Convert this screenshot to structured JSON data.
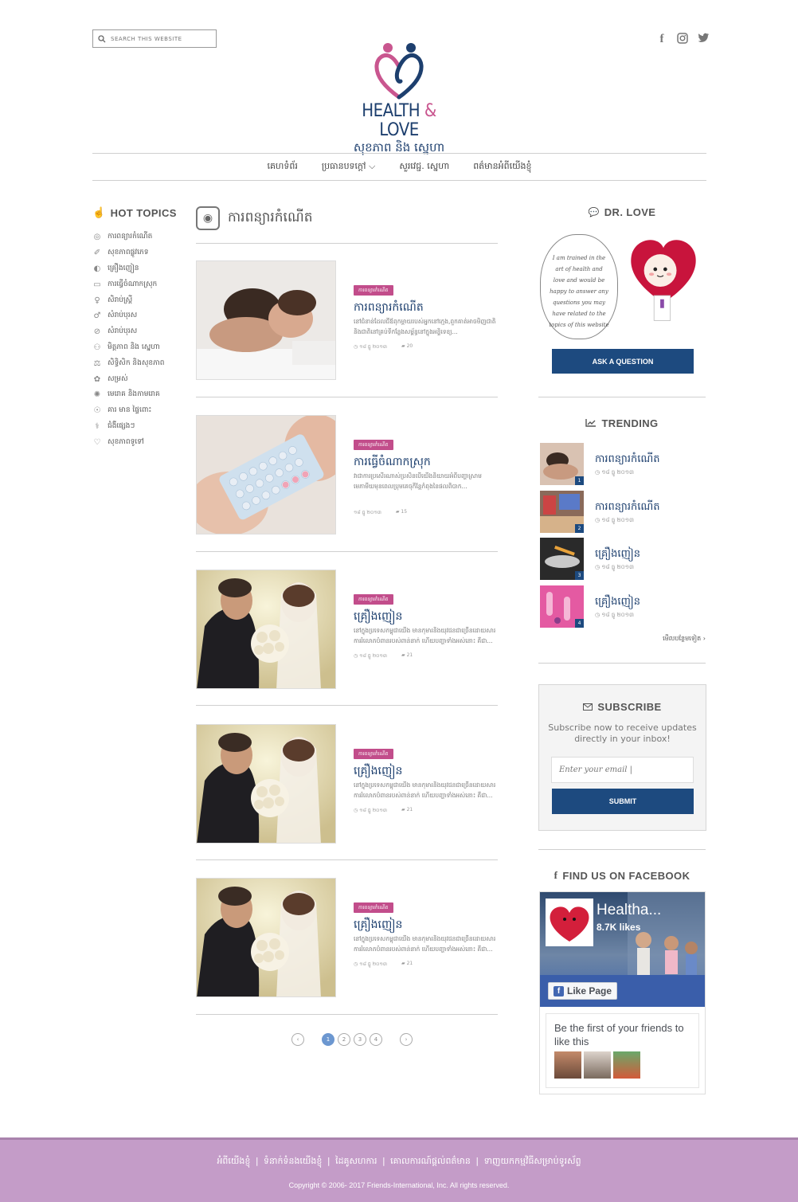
{
  "search": {
    "placeholder": "SEARCH THIS WEBSITE"
  },
  "social": {
    "icons": [
      "facebook-icon",
      "instagram-icon",
      "twitter-icon"
    ]
  },
  "logo": {
    "title_en_1": "HEALTH ",
    "amp": "&",
    "title_en_2": " LOVE",
    "title_km": "សុខភាព និង ស្នេហា"
  },
  "nav": {
    "items": [
      "គេហទំព័រ",
      "ប្រធានបទក្តៅ ⌵",
      "សួរវេជ្ជ. ស្នេហា",
      "ពត៌មានអំពីយើងខ្ញុំ"
    ]
  },
  "hot_topics": {
    "title": "HOT TOPICS",
    "items": [
      "ការពន្យារកំណើត",
      "សុខភាពផ្លូវភេទ",
      "គ្រឿងញៀន",
      "ការធ្វើចំណាកស្រុក",
      "សិរាប់ស្រ្តី",
      "សំរាប់បុរស",
      "សំរាប់បុរស",
      "មិត្តភាព និង ស្នេហា",
      "សិទ្ធិសិក និងសុខភាព",
      "សម្រស់",
      "មេរោគ និងកាមរោគ",
      "គារ មាន ផ្ទៃពោះ",
      "ជំងឺផ្សេងៗ",
      "សុខភាពទូទៅ"
    ]
  },
  "section": {
    "title": "ការពន្យារកំណើត"
  },
  "posts": [
    {
      "tag": "ការពន្យារកំណើត",
      "title": "ការពន្យារកំណើត",
      "excerpt": "នៅជំនាន់ដែលជីឪពុកម្តាយរបស់អ្នកនៅក្មេង,ពួកគាត់អាចមិញជាតិនិងជាតិនៅគ្រប់ទីកន្លែងសម្ព័ន្ធនៅក្នុងអន្ទិទេខ្យ...",
      "date": "១៨ ធ្នូ ២០១៣",
      "comments": "20"
    },
    {
      "tag": "ការពន្យារកំណើត",
      "title": "ការធ្វើចំណាកស្រុក",
      "excerpt": "វាជាការប្រសើរណាស់ប្រសិនបើយើងនិយាយអំពីបញ្ហាស្រាមមេភាមីយមុនពេលប្រុមគេចុកីន្តែកំពុងនៃផលពិបាក...",
      "date": "១៨ ធ្នូ ២០១៣",
      "comments": "15"
    },
    {
      "tag": "ការពន្យារកំណើត",
      "title": "គ្រឿងញៀន",
      "excerpt": "នៅក្នុងប្រទេសកម្ពុជាយើង មានកុមារនិងយុវជនជាច្រើនដោយសារការរំលោភបំពានរបស់ពាន់នាក់ ហើយបញ្ហាទាំងអស់នោះ គឺជា...",
      "date": "១៨ ធ្នូ ២០១៣",
      "comments": "21"
    },
    {
      "tag": "ការពន្យារកំណើត",
      "title": "គ្រឿងញៀន",
      "excerpt": "នៅក្នុងប្រទេសកម្ពុជាយើង មានកុមារនិងយុវជនជាច្រើនដោយសារការរំលោភបំពានរបស់ពាន់នាក់ ហើយបញ្ហាទាំងអស់នោះ គឺជា...",
      "date": "១៨ ធ្នូ ២០១៣",
      "comments": "21"
    },
    {
      "tag": "ការពន្យារកំណើត",
      "title": "គ្រឿងញៀន",
      "excerpt": "នៅក្នុងប្រទេសកម្ពុជាយើង មានកុមារនិងយុវជនជាច្រើនដោយសារការរំលោភបំពានរបស់ពាន់នាក់ ហើយបញ្ហាទាំងអស់នោះ គឺជា...",
      "date": "១៨ ធ្នូ ២០១៣",
      "comments": "21"
    }
  ],
  "pagination": {
    "pages": [
      "1",
      "2",
      "3",
      "4"
    ],
    "current": "1",
    "prev": "‹",
    "next": "›"
  },
  "dr_love": {
    "title": "DR. LOVE",
    "bubble_text": "I am trained in the art of health and love and would be happy to answer any questions you may have related to the topics of this website",
    "button": "ASK A QUESTION"
  },
  "trending": {
    "title": "TRENDING",
    "items": [
      {
        "rank": "1",
        "title": "ការពន្យារកំណើត",
        "date": "១៨ ធ្នូ ២០១៣"
      },
      {
        "rank": "2",
        "title": "ការពន្យារកំណើត",
        "date": "១៨ ធ្នូ ២០១៣"
      },
      {
        "rank": "3",
        "title": "គ្រឿងញៀន",
        "date": "១៨ ធ្នូ ២០១៣"
      },
      {
        "rank": "4",
        "title": "គ្រឿងញៀន",
        "date": "១៨ ធ្នូ ២០១៣"
      }
    ],
    "more": "មើលបន្ថែមទៀត ›"
  },
  "subscribe": {
    "title": "SUBSCRIBE",
    "text": "Subscribe now to receive updates directly in your inbox!",
    "placeholder": "Enter your email |",
    "button": "SUBMIT"
  },
  "facebook": {
    "title": "FIND US ON FACEBOOK",
    "page_name": "Healtha...",
    "likes": "8.7K likes",
    "like_button": "Like Page",
    "friends_text": "Be the first of your friends to like this"
  },
  "footer": {
    "links": [
      "អំពីយើងខ្ញុំ",
      "ទំនាក់ទំនងយើងខ្ញុំ",
      "ដៃគូសហការ",
      "គោលការណ៍ផ្តល់ពត៌មាន",
      "ទាញយកកម្មវិធីសម្រាប់ទូរស័ព្ទ"
    ],
    "copyright": "Copyright © 2006- 2017 Friends-International, Inc. All rights reserved."
  },
  "colors": {
    "brand_navy": "#1d3f6e",
    "button_navy": "#1d4a7f",
    "tag_magenta": "#c24d8b",
    "footer_purple": "#c49cc8"
  }
}
